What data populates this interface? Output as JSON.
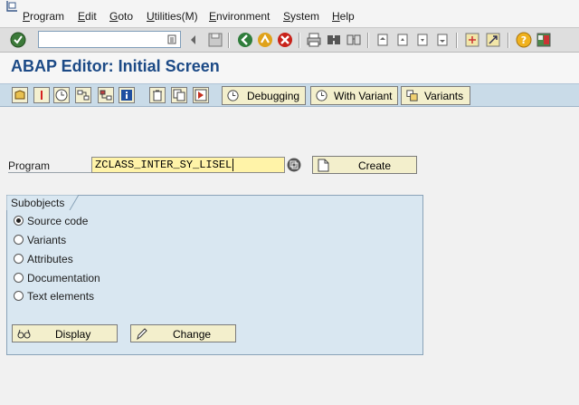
{
  "menu": {
    "items": [
      {
        "label": "Program",
        "ul": "P",
        "rest": "rogram"
      },
      {
        "label": "Edit",
        "ul": "E",
        "rest": "dit"
      },
      {
        "label": "Goto",
        "ul": "G",
        "rest": "oto"
      },
      {
        "label": "Utilities(M)",
        "ul": "U",
        "rest": "tilities(M)"
      },
      {
        "label": "Environment",
        "ul": "E",
        "rest": "nvironment"
      },
      {
        "label": "System",
        "ul": "S",
        "rest": "ystem"
      },
      {
        "label": "Help",
        "ul": "H",
        "rest": "elp"
      }
    ]
  },
  "command_field": {
    "value": ""
  },
  "title": "ABAP Editor: Initial Screen",
  "app_toolbar": {
    "debugging_label": "Debugging",
    "with_variant_label": "With Variant",
    "variants_label": "Variants"
  },
  "program": {
    "label": "Program",
    "value": "ZCLASS_INTER_SY_LISEL",
    "create_label": "Create"
  },
  "subobjects": {
    "title": "Subobjects",
    "options": [
      {
        "label": "Source code",
        "selected": true
      },
      {
        "label": "Variants",
        "selected": false
      },
      {
        "label": "Attributes",
        "selected": false
      },
      {
        "label": "Documentation",
        "selected": false
      },
      {
        "label": "Text elements",
        "selected": false
      }
    ],
    "display_label": "Display",
    "change_label": "Change"
  },
  "colors": {
    "title": "#1c4a86",
    "app_toolbar_bg": "#c9dbe8",
    "program_input_bg": "#fff3a8",
    "group_bg": "#d9e7f1",
    "button_bg": "#f3efcc"
  }
}
